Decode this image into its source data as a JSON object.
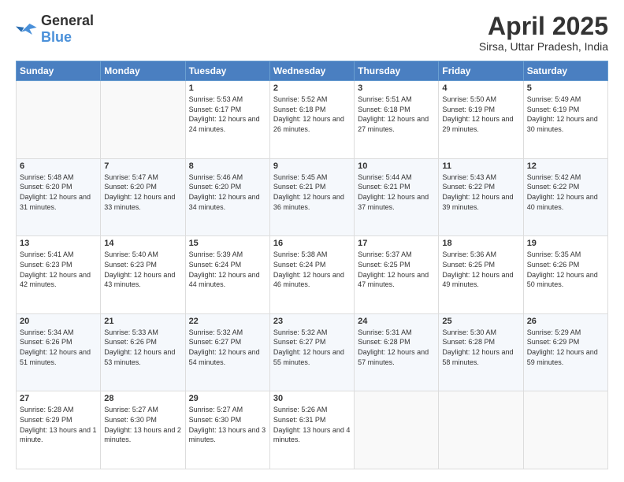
{
  "header": {
    "logo_general": "General",
    "logo_blue": "Blue",
    "title": "April 2025",
    "location": "Sirsa, Uttar Pradesh, India"
  },
  "columns": [
    "Sunday",
    "Monday",
    "Tuesday",
    "Wednesday",
    "Thursday",
    "Friday",
    "Saturday"
  ],
  "weeks": [
    [
      {
        "day": "",
        "sunrise": "",
        "sunset": "",
        "daylight": ""
      },
      {
        "day": "",
        "sunrise": "",
        "sunset": "",
        "daylight": ""
      },
      {
        "day": "1",
        "sunrise": "Sunrise: 5:53 AM",
        "sunset": "Sunset: 6:17 PM",
        "daylight": "Daylight: 12 hours and 24 minutes."
      },
      {
        "day": "2",
        "sunrise": "Sunrise: 5:52 AM",
        "sunset": "Sunset: 6:18 PM",
        "daylight": "Daylight: 12 hours and 26 minutes."
      },
      {
        "day": "3",
        "sunrise": "Sunrise: 5:51 AM",
        "sunset": "Sunset: 6:18 PM",
        "daylight": "Daylight: 12 hours and 27 minutes."
      },
      {
        "day": "4",
        "sunrise": "Sunrise: 5:50 AM",
        "sunset": "Sunset: 6:19 PM",
        "daylight": "Daylight: 12 hours and 29 minutes."
      },
      {
        "day": "5",
        "sunrise": "Sunrise: 5:49 AM",
        "sunset": "Sunset: 6:19 PM",
        "daylight": "Daylight: 12 hours and 30 minutes."
      }
    ],
    [
      {
        "day": "6",
        "sunrise": "Sunrise: 5:48 AM",
        "sunset": "Sunset: 6:20 PM",
        "daylight": "Daylight: 12 hours and 31 minutes."
      },
      {
        "day": "7",
        "sunrise": "Sunrise: 5:47 AM",
        "sunset": "Sunset: 6:20 PM",
        "daylight": "Daylight: 12 hours and 33 minutes."
      },
      {
        "day": "8",
        "sunrise": "Sunrise: 5:46 AM",
        "sunset": "Sunset: 6:20 PM",
        "daylight": "Daylight: 12 hours and 34 minutes."
      },
      {
        "day": "9",
        "sunrise": "Sunrise: 5:45 AM",
        "sunset": "Sunset: 6:21 PM",
        "daylight": "Daylight: 12 hours and 36 minutes."
      },
      {
        "day": "10",
        "sunrise": "Sunrise: 5:44 AM",
        "sunset": "Sunset: 6:21 PM",
        "daylight": "Daylight: 12 hours and 37 minutes."
      },
      {
        "day": "11",
        "sunrise": "Sunrise: 5:43 AM",
        "sunset": "Sunset: 6:22 PM",
        "daylight": "Daylight: 12 hours and 39 minutes."
      },
      {
        "day": "12",
        "sunrise": "Sunrise: 5:42 AM",
        "sunset": "Sunset: 6:22 PM",
        "daylight": "Daylight: 12 hours and 40 minutes."
      }
    ],
    [
      {
        "day": "13",
        "sunrise": "Sunrise: 5:41 AM",
        "sunset": "Sunset: 6:23 PM",
        "daylight": "Daylight: 12 hours and 42 minutes."
      },
      {
        "day": "14",
        "sunrise": "Sunrise: 5:40 AM",
        "sunset": "Sunset: 6:23 PM",
        "daylight": "Daylight: 12 hours and 43 minutes."
      },
      {
        "day": "15",
        "sunrise": "Sunrise: 5:39 AM",
        "sunset": "Sunset: 6:24 PM",
        "daylight": "Daylight: 12 hours and 44 minutes."
      },
      {
        "day": "16",
        "sunrise": "Sunrise: 5:38 AM",
        "sunset": "Sunset: 6:24 PM",
        "daylight": "Daylight: 12 hours and 46 minutes."
      },
      {
        "day": "17",
        "sunrise": "Sunrise: 5:37 AM",
        "sunset": "Sunset: 6:25 PM",
        "daylight": "Daylight: 12 hours and 47 minutes."
      },
      {
        "day": "18",
        "sunrise": "Sunrise: 5:36 AM",
        "sunset": "Sunset: 6:25 PM",
        "daylight": "Daylight: 12 hours and 49 minutes."
      },
      {
        "day": "19",
        "sunrise": "Sunrise: 5:35 AM",
        "sunset": "Sunset: 6:26 PM",
        "daylight": "Daylight: 12 hours and 50 minutes."
      }
    ],
    [
      {
        "day": "20",
        "sunrise": "Sunrise: 5:34 AM",
        "sunset": "Sunset: 6:26 PM",
        "daylight": "Daylight: 12 hours and 51 minutes."
      },
      {
        "day": "21",
        "sunrise": "Sunrise: 5:33 AM",
        "sunset": "Sunset: 6:26 PM",
        "daylight": "Daylight: 12 hours and 53 minutes."
      },
      {
        "day": "22",
        "sunrise": "Sunrise: 5:32 AM",
        "sunset": "Sunset: 6:27 PM",
        "daylight": "Daylight: 12 hours and 54 minutes."
      },
      {
        "day": "23",
        "sunrise": "Sunrise: 5:32 AM",
        "sunset": "Sunset: 6:27 PM",
        "daylight": "Daylight: 12 hours and 55 minutes."
      },
      {
        "day": "24",
        "sunrise": "Sunrise: 5:31 AM",
        "sunset": "Sunset: 6:28 PM",
        "daylight": "Daylight: 12 hours and 57 minutes."
      },
      {
        "day": "25",
        "sunrise": "Sunrise: 5:30 AM",
        "sunset": "Sunset: 6:28 PM",
        "daylight": "Daylight: 12 hours and 58 minutes."
      },
      {
        "day": "26",
        "sunrise": "Sunrise: 5:29 AM",
        "sunset": "Sunset: 6:29 PM",
        "daylight": "Daylight: 12 hours and 59 minutes."
      }
    ],
    [
      {
        "day": "27",
        "sunrise": "Sunrise: 5:28 AM",
        "sunset": "Sunset: 6:29 PM",
        "daylight": "Daylight: 13 hours and 1 minute."
      },
      {
        "day": "28",
        "sunrise": "Sunrise: 5:27 AM",
        "sunset": "Sunset: 6:30 PM",
        "daylight": "Daylight: 13 hours and 2 minutes."
      },
      {
        "day": "29",
        "sunrise": "Sunrise: 5:27 AM",
        "sunset": "Sunset: 6:30 PM",
        "daylight": "Daylight: 13 hours and 3 minutes."
      },
      {
        "day": "30",
        "sunrise": "Sunrise: 5:26 AM",
        "sunset": "Sunset: 6:31 PM",
        "daylight": "Daylight: 13 hours and 4 minutes."
      },
      {
        "day": "",
        "sunrise": "",
        "sunset": "",
        "daylight": ""
      },
      {
        "day": "",
        "sunrise": "",
        "sunset": "",
        "daylight": ""
      },
      {
        "day": "",
        "sunrise": "",
        "sunset": "",
        "daylight": ""
      }
    ]
  ]
}
